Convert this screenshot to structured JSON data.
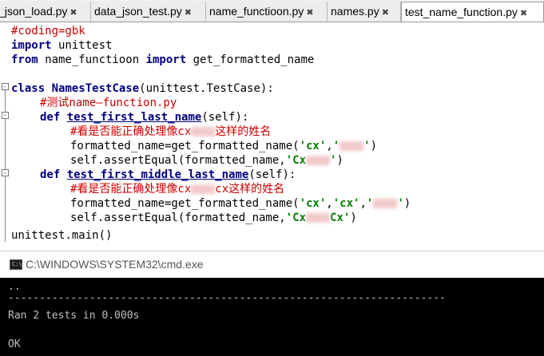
{
  "tabs": [
    {
      "label": "_json_load.py",
      "active": false
    },
    {
      "label": "data_json_test.py",
      "active": false
    },
    {
      "label": "name_functioon.py",
      "active": false
    },
    {
      "label": "names.py",
      "active": false
    },
    {
      "label": "test_name_function.py",
      "active": true
    }
  ],
  "tab_close_glyph": "✖",
  "code": {
    "l1": "#coding=gbk",
    "l2_kw": "import",
    "l2_rest": " unittest",
    "l3_kw1": "from",
    "l3_mid": " name_functioon ",
    "l3_kw2": "import",
    "l3_rest": " get_formatted_name",
    "l5_kw": "class",
    "l5_name": "NamesTestCase",
    "l5_rest": "(unittest.TestCase):",
    "l6_comment": "#测试name—function.py",
    "l7_kw": "def",
    "l7_name": "test_first_last_name",
    "l7_rest": "(self):",
    "l8_comment_a": "#看是否能正确处理像cx",
    "l8_comment_b": "这样的姓名",
    "l9_a": "formatted_name=get_formatted_name(",
    "l9_s1": "'cx'",
    "l9_comma": ",",
    "l9_s2_a": "'",
    "l9_s2_b": "'",
    "l9_end": ")",
    "l10_a": "self.assertEqual(formatted_name,",
    "l10_s_a": "'Cx",
    "l10_s_b": "'",
    "l10_end": ")",
    "l11_kw": "def",
    "l11_name": "test_first_middle_last_name",
    "l11_rest": "(self):",
    "l12_comment_a": "#看是否能正确处理像cx",
    "l12_comment_b": "cx这样的姓名",
    "l13_a": "formatted_name=get_formatted_name(",
    "l13_s1": "'cx'",
    "l13_c1": ",",
    "l13_s2": "'cx'",
    "l13_c2": ",",
    "l13_s3_a": "'",
    "l13_s3_b": "'",
    "l13_end": ")",
    "l14_a": "self.assertEqual(formatted_name,",
    "l14_s_a": "'Cx",
    "l14_s_b": "Cx'",
    "l14_end": ")",
    "l15": "unittest.main()"
  },
  "cmd": {
    "title": "C:\\WINDOWS\\SYSTEM32\\cmd.exe",
    "icon_text": "C:\\",
    "line1": "..",
    "line2": "----------------------------------------------------------------------",
    "line3": "Ran 2 tests in 0.000s",
    "line4": "OK"
  }
}
